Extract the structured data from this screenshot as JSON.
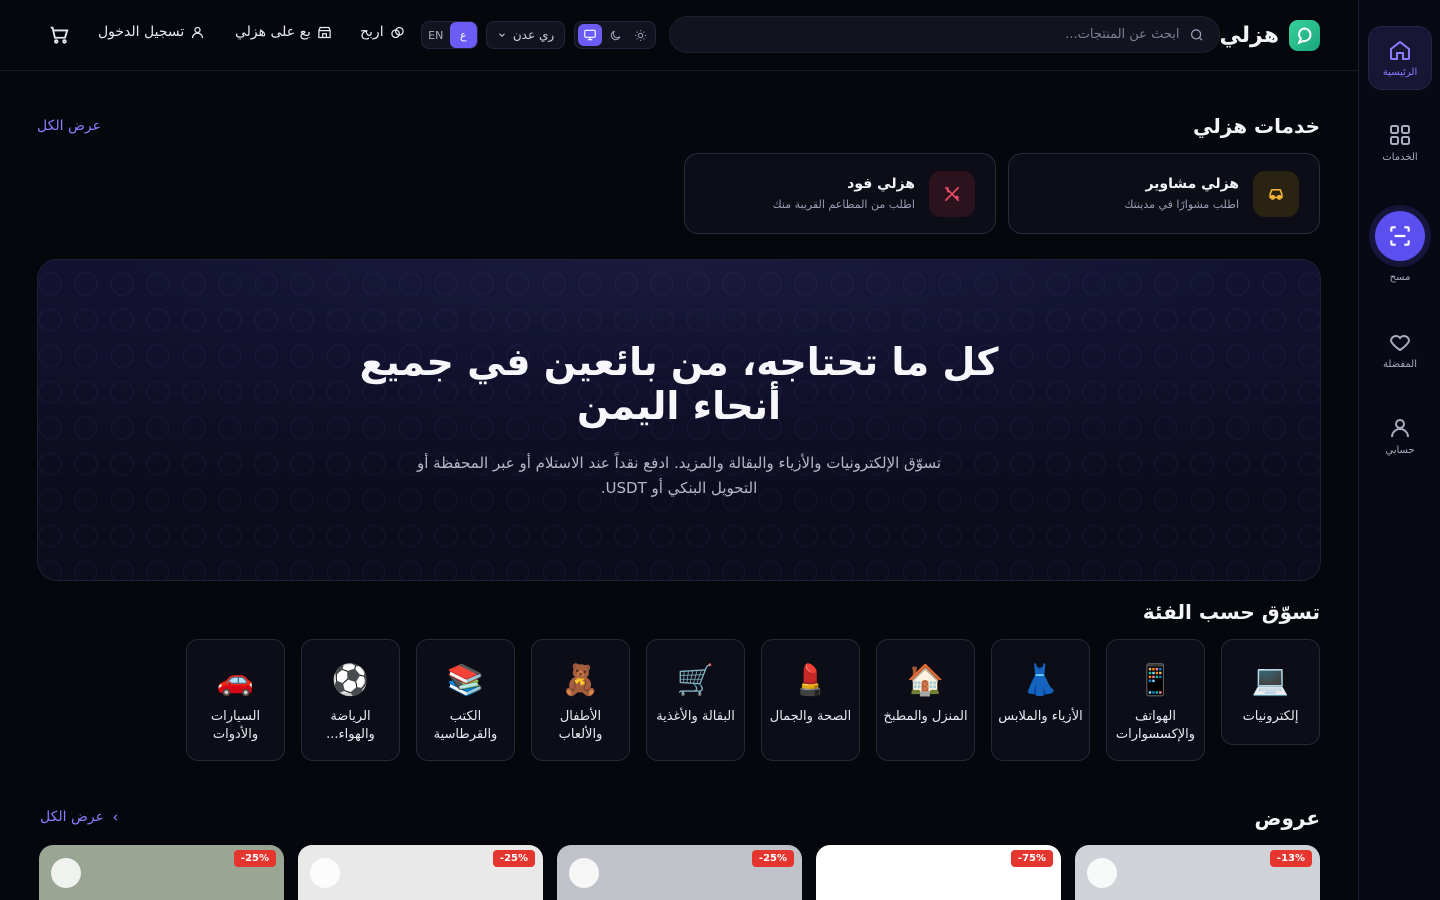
{
  "header": {
    "brand": "هزلي",
    "search_placeholder": "ابحث عن المنتجات...",
    "currency": "ري عدن",
    "lang_en": "EN",
    "lang_ar": "ع",
    "earn": "اربح",
    "sell": "بع على هزلي",
    "login": "تسجيل الدخول"
  },
  "rail": {
    "home": "الرئيسية",
    "services": "الخدمات",
    "scan": "مسح",
    "favorites": "المفضلة",
    "account": "حسابي"
  },
  "services": {
    "title": "خدمات هزلي",
    "view_all": "عرض الكل",
    "items": [
      {
        "title": "هزلي مشاوير",
        "subtitle": "اطلب مشوارًا في مدينتك",
        "icon": "car-icon",
        "color": "#f0b23a"
      },
      {
        "title": "هزلي فود",
        "subtitle": "اطلب من المطاعم القريبة منك",
        "icon": "utensils-icon",
        "color": "#ef4e6a"
      }
    ]
  },
  "hero": {
    "title": "كل ما تحتاجه، من بائعين في جميع أنحاء اليمن",
    "subtitle": "تسوّق الإلكترونيات والأزياء والبقالة والمزيد. ادفع نقداً عند الاستلام أو عبر المحفظة أو التحويل البنكي أو USDT."
  },
  "categories": {
    "title": "تسوّق حسب الفئة",
    "items": [
      {
        "label": "إلكترونيات",
        "emoji": "💻"
      },
      {
        "label": "الهواتف والإكسسوارات",
        "emoji": "📱"
      },
      {
        "label": "الأزياء والملابس",
        "emoji": "👗"
      },
      {
        "label": "المنزل والمطبخ",
        "emoji": "🏠"
      },
      {
        "label": "الصحة والجمال",
        "emoji": "💄"
      },
      {
        "label": "البقالة والأغذية",
        "emoji": "🛒"
      },
      {
        "label": "الأطفال والألعاب",
        "emoji": "🧸"
      },
      {
        "label": "الكتب والقرطاسية",
        "emoji": "📚"
      },
      {
        "label": "الرياضة والهواء...",
        "emoji": "⚽"
      },
      {
        "label": "السيارات والأدوات",
        "emoji": "🚗"
      }
    ]
  },
  "deals": {
    "title": "عروض",
    "view_all": "عرض الكل",
    "items": [
      {
        "discount": "13%-",
        "bg": "#cfd3d8"
      },
      {
        "discount": "75%-",
        "bg": "#ffffff"
      },
      {
        "discount": "25%-",
        "bg": "#bfc3c9"
      },
      {
        "discount": "25%-",
        "bg": "#e9e9ea"
      },
      {
        "discount": "25%-",
        "bg": "#9aa594"
      }
    ]
  },
  "colors": {
    "accent": "#6c5cf5",
    "badge": "#e5352f"
  }
}
